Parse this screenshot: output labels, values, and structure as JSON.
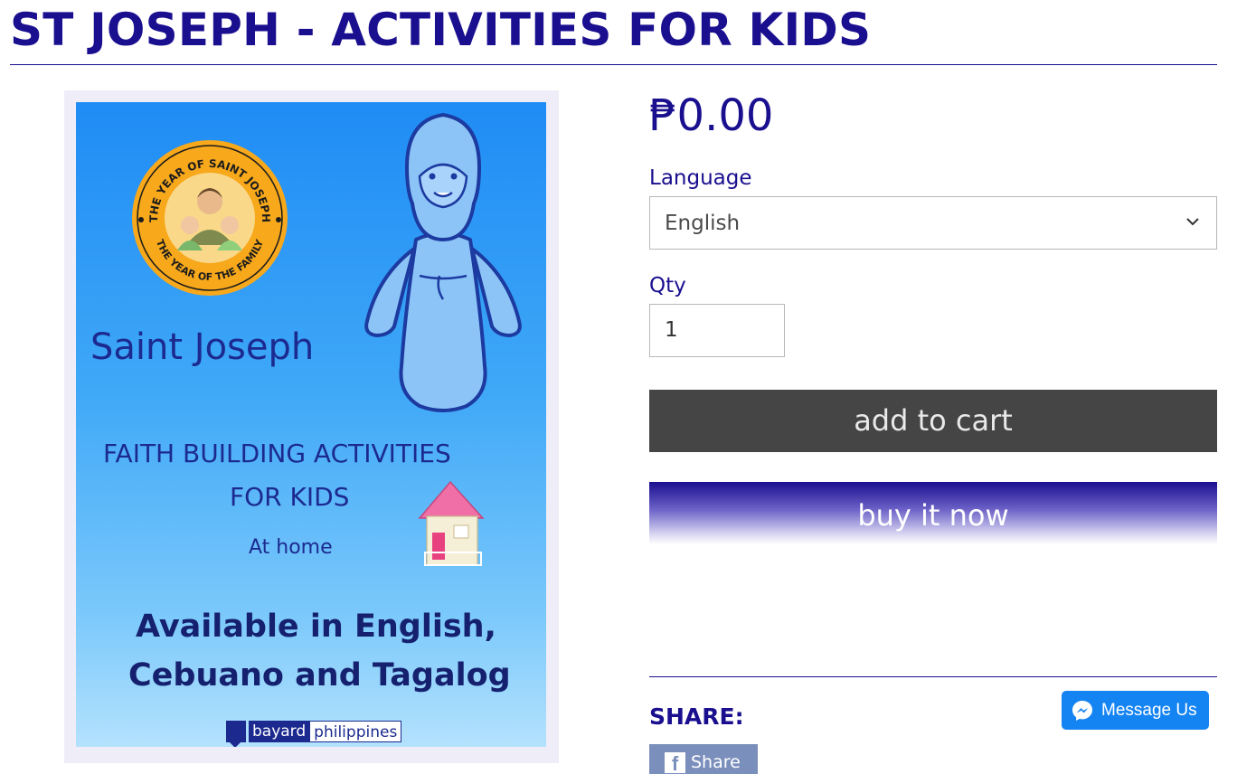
{
  "page": {
    "title": "ST JOSEPH - ACTIVITIES FOR KIDS"
  },
  "product_image": {
    "seal_text_top": "THE YEAR OF SAINT JOSEPH",
    "seal_text_bottom": "THE YEAR OF THE FAMILY",
    "name": "Saint Joseph",
    "subtitle_line1": "FAITH BUILDING ACTIVITIES",
    "subtitle_line2": "FOR KIDS",
    "subtitle_line3": "At home",
    "availability_line1": "Available in English,",
    "availability_line2": "Cebuano and Tagalog",
    "publisher_part1": "bayard",
    "publisher_part2": "philippines"
  },
  "product": {
    "price": "₱0.00",
    "language_label": "Language",
    "language_selected": "English",
    "qty_label": "Qty",
    "qty_value": "1",
    "add_to_cart": "add to cart",
    "buy_now": "buy it now"
  },
  "share": {
    "label": "SHARE:",
    "facebook_share": "Share",
    "messenger_label": "Message Us"
  },
  "icons": {
    "dropdown": "chevron-down-icon",
    "facebook": "facebook-icon",
    "messenger": "messenger-icon"
  },
  "colors": {
    "brand": "#1a0f8f",
    "cart_button": "#454545",
    "messenger": "#1584f3",
    "facebook_share": "#7b8fbc"
  }
}
